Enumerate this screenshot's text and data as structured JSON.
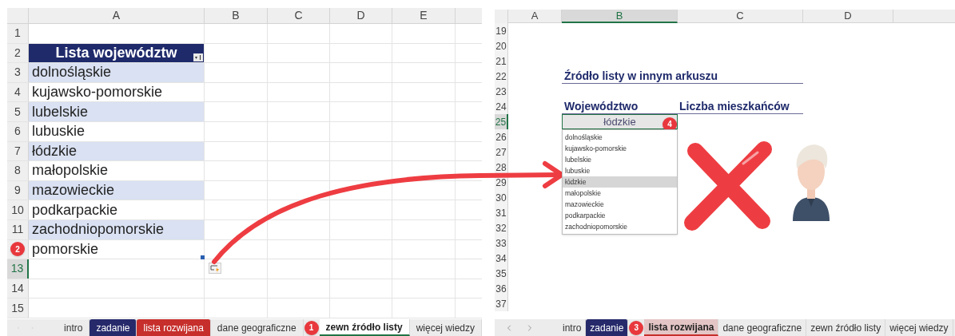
{
  "left_sheet": {
    "columns": [
      {
        "label": "A",
        "selected": false
      },
      {
        "label": "B",
        "selected": false
      },
      {
        "label": "C",
        "selected": false
      },
      {
        "label": "D",
        "selected": false
      },
      {
        "label": "E",
        "selected": false
      }
    ],
    "row_headers": [
      {
        "label": "1",
        "selected": false
      },
      {
        "label": "2",
        "selected": false
      },
      {
        "label": "3",
        "selected": false
      },
      {
        "label": "4",
        "selected": false
      },
      {
        "label": "5",
        "selected": false
      },
      {
        "label": "6",
        "selected": false
      },
      {
        "label": "7",
        "selected": false
      },
      {
        "label": "8",
        "selected": false
      },
      {
        "label": "9",
        "selected": false
      },
      {
        "label": "10",
        "selected": false
      },
      {
        "label": "11",
        "selected": false
      },
      {
        "badge": "2",
        "selected": false
      },
      {
        "label": "13",
        "selected": true
      },
      {
        "label": "14",
        "selected": false
      },
      {
        "label": "15",
        "selected": false
      }
    ],
    "table": {
      "header": "Lista województw",
      "items": [
        "dolnośląskie",
        "kujawsko-pomorskie",
        "lubelskie",
        "lubuskie",
        "łódzkie",
        "małopolskie",
        "mazowieckie",
        "podkarpackie",
        "zachodniopomorskie",
        "pomorskie"
      ]
    },
    "tabs": [
      {
        "label": "intro",
        "selected": false
      },
      {
        "label": "zadanie",
        "selected": false,
        "color": "#262a6b"
      },
      {
        "label": "lista rozwijana",
        "selected": false,
        "color": "#c62f2c"
      },
      {
        "label": "dane geograficzne",
        "selected": false
      },
      {
        "label": "zewn źródło listy",
        "selected": true,
        "badge": "1"
      },
      {
        "label": "więcej wiedzy",
        "selected": false
      }
    ]
  },
  "right_sheet": {
    "columns": [
      {
        "label": "A",
        "selected": false
      },
      {
        "label": "B",
        "selected": true
      },
      {
        "label": "C",
        "selected": false
      },
      {
        "label": "D",
        "selected": false
      }
    ],
    "row_headers": [
      {
        "label": "19",
        "selected": false
      },
      {
        "label": "20",
        "selected": false
      },
      {
        "label": "21",
        "selected": false
      },
      {
        "label": "22",
        "selected": false
      },
      {
        "label": "23",
        "selected": false
      },
      {
        "label": "24",
        "selected": false
      },
      {
        "label": "25",
        "selected": true
      },
      {
        "label": "26",
        "selected": false
      },
      {
        "label": "27",
        "selected": false
      },
      {
        "label": "28",
        "selected": false
      },
      {
        "label": "29",
        "selected": false
      },
      {
        "label": "30",
        "selected": false
      },
      {
        "label": "31",
        "selected": false
      },
      {
        "label": "32",
        "selected": false
      },
      {
        "label": "33",
        "selected": false
      },
      {
        "label": "34",
        "selected": false
      },
      {
        "label": "35",
        "selected": false
      },
      {
        "label": "36",
        "selected": false
      },
      {
        "label": "37",
        "selected": false
      }
    ],
    "title": "Źródło listy w innym arkuszu",
    "field_labels": [
      "Województwo",
      "Liczba mieszkańców"
    ],
    "dropdown": {
      "value": "łódzkie",
      "badge": "4",
      "options": [
        {
          "label": "dolnośląskie",
          "selected": false
        },
        {
          "label": "kujawsko-pomorskie",
          "selected": false
        },
        {
          "label": "lubelskie",
          "selected": false
        },
        {
          "label": "lubuskie",
          "selected": false
        },
        {
          "label": "łódzkie",
          "selected": true
        },
        {
          "label": "małopolskie",
          "selected": false
        },
        {
          "label": "mazowieckie",
          "selected": false
        },
        {
          "label": "podkarpackie",
          "selected": false
        },
        {
          "label": "zachodniopomorskie",
          "selected": false
        }
      ]
    },
    "tabs": [
      {
        "label": "intro",
        "selected": false
      },
      {
        "label": "zadanie",
        "selected": false,
        "color": "#262a6b"
      },
      {
        "label": "lista rozwijana",
        "selected": true,
        "color": "#c62f2c",
        "badge": "3"
      },
      {
        "label": "dane geograficzne",
        "selected": false
      },
      {
        "label": "zewn źródło listy",
        "selected": false
      },
      {
        "label": "więcej wiedzy",
        "selected": false
      }
    ]
  }
}
